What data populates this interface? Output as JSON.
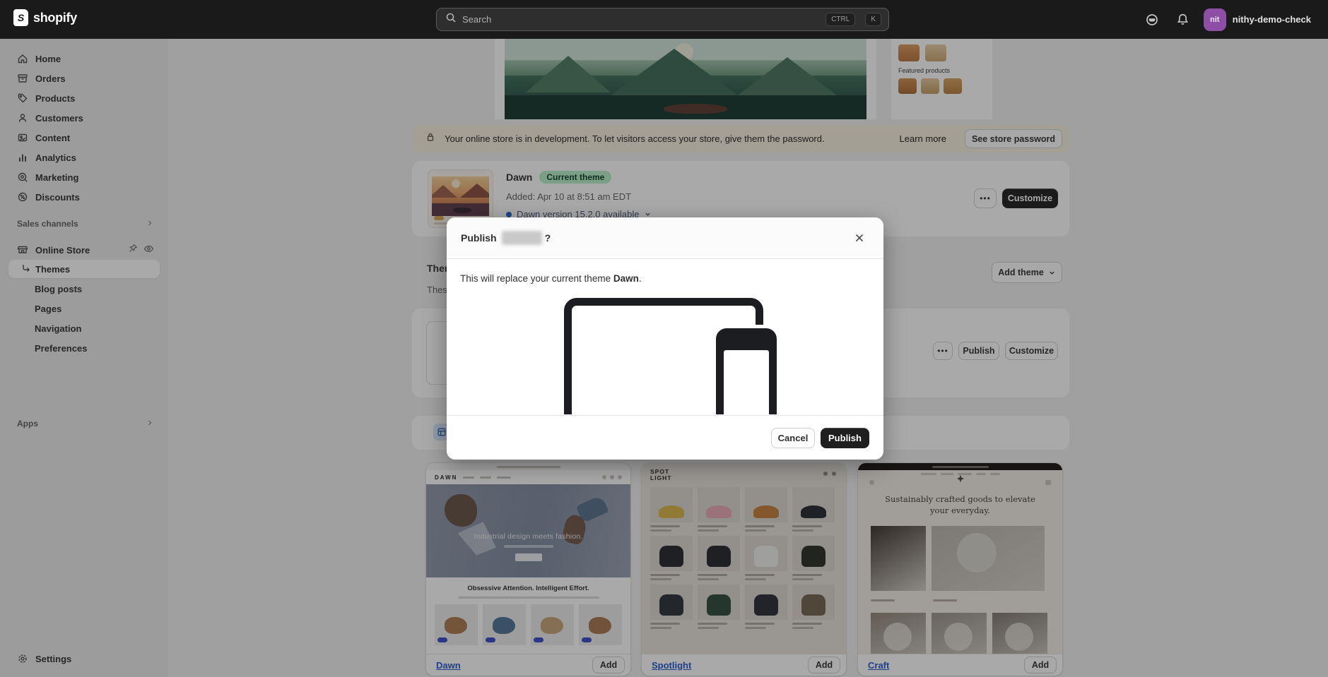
{
  "topbar": {
    "logo_text": "shopify",
    "logo_letter": "S",
    "search_placeholder": "Search",
    "shortcut_keys": [
      "CTRL",
      "K"
    ],
    "store_initials": "nit",
    "store_name": "nithy-demo-check",
    "avatar_color": "#8c4fa5"
  },
  "sidebar": {
    "items": [
      {
        "label": "Home",
        "icon": "home-icon"
      },
      {
        "label": "Orders",
        "icon": "orders-icon"
      },
      {
        "label": "Products",
        "icon": "products-icon"
      },
      {
        "label": "Customers",
        "icon": "customers-icon"
      },
      {
        "label": "Content",
        "icon": "content-icon"
      },
      {
        "label": "Analytics",
        "icon": "analytics-icon"
      },
      {
        "label": "Marketing",
        "icon": "marketing-icon"
      },
      {
        "label": "Discounts",
        "icon": "discounts-icon"
      }
    ],
    "sales_channels_label": "Sales channels",
    "online_store_label": "Online Store",
    "online_store_children": [
      "Themes",
      "Blog posts",
      "Pages",
      "Navigation",
      "Preferences"
    ],
    "selected_child": "Themes",
    "apps_label": "Apps",
    "settings_label": "Settings"
  },
  "preview_fragment": {
    "featured_products_label": "Featured products"
  },
  "dev_banner": {
    "text": "Your online store is in development. To let visitors access your store, give them the password.",
    "learn_more": "Learn more",
    "button": "See store password"
  },
  "current_theme": {
    "name": "Dawn",
    "badge": "Current theme",
    "added": "Added: Apr 10 at 8:51 am EDT",
    "update_notice": "Dawn version 15.2.0 available",
    "menu_dots": "•••",
    "customize": "Customize"
  },
  "theme_library": {
    "heading": "Theme library",
    "description_start": "These",
    "add_theme": "Add theme",
    "row_menu_dots": "•••",
    "row_publish": "Publish",
    "row_customize": "Customize"
  },
  "modal": {
    "title_prefix": "Publish",
    "title_suffix": "?",
    "body_prefix": "This will replace your current theme ",
    "body_theme": "Dawn",
    "body_suffix": ".",
    "cancel": "Cancel",
    "publish": "Publish"
  },
  "theme_cards": [
    {
      "name": "Dawn",
      "add_label": "Add",
      "store_logo": "DAWN",
      "hero_headline": "Industrial design meets fashion.",
      "section_headline": "Obsessive Attention. Intelligent Effort.",
      "product_colors": [
        "#ad7a50",
        "#4e7296",
        "#c4a478",
        "#a9764f"
      ]
    },
    {
      "name": "Spotlight",
      "add_label": "Add",
      "logo_line1": "SPOT",
      "logo_line2": "LIGHT",
      "tile_rows": [
        [
          "#d9b34a",
          "#e8a8b0",
          "#c57f3a",
          "#232830"
        ],
        [
          "#23262b",
          "#24272c",
          "#f0efed",
          "#2a2e25"
        ],
        [
          "#2c3038",
          "#2e4a3f",
          "#2b2d36",
          "#73624e"
        ]
      ]
    },
    {
      "name": "Craft",
      "add_label": "Add",
      "headline_line1": "Sustainably crafted goods to elevate",
      "headline_line2": "your everyday.",
      "row1_colors": [
        "#3c332b",
        "#b9b5ae"
      ],
      "row2_colors": [
        "#8e8578",
        "#99928a",
        "#80796f"
      ]
    }
  ]
}
